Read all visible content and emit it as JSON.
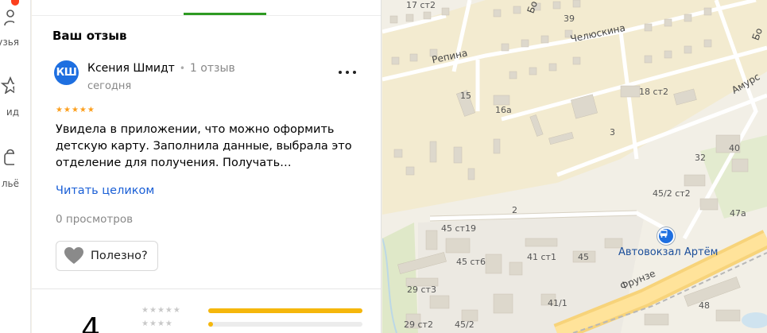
{
  "rail": {
    "items": [
      {
        "label": "узья",
        "icon": "friends-icon"
      },
      {
        "label": "ид",
        "icon": "star-icon"
      },
      {
        "label": "льё",
        "icon": "bag-icon"
      }
    ]
  },
  "review": {
    "section_title": "Ваш отзыв",
    "author": {
      "initials": "КШ",
      "name": "Ксения Шмидт",
      "separator": "•",
      "reviews_count": "1 отзыв",
      "date": "сегодня"
    },
    "rating_stars": [
      "★",
      "★",
      "★",
      "★",
      "★"
    ],
    "text": "Увидела в приложении, что можно оформить детскую карту. Заполнила данные, выбрала это отделение для получения. Получать…",
    "read_more": "Читать целиком",
    "views": "0 просмотров",
    "useful_label": "Полезно?"
  },
  "rating_summary": {
    "value": "4",
    "distribution": [
      {
        "stars": [
          "★",
          "★",
          "★",
          "★",
          "★"
        ],
        "fraction": 1.0
      },
      {
        "stars": [
          "★",
          "★",
          "★",
          "★"
        ],
        "fraction": 0.03
      }
    ]
  },
  "map": {
    "labels": [
      {
        "text": "17 ст2",
        "kind": "house"
      },
      {
        "text": "39",
        "kind": "house"
      },
      {
        "text": "Репина",
        "kind": "street"
      },
      {
        "text": "Челюскина",
        "kind": "street"
      },
      {
        "text": "15",
        "kind": "house"
      },
      {
        "text": "16а",
        "kind": "house"
      },
      {
        "text": "18 ст2",
        "kind": "house"
      },
      {
        "text": "Амурс",
        "kind": "street"
      },
      {
        "text": "3",
        "kind": "house"
      },
      {
        "text": "40",
        "kind": "house"
      },
      {
        "text": "32",
        "kind": "house"
      },
      {
        "text": "45/2 ст2",
        "kind": "house"
      },
      {
        "text": "2",
        "kind": "house"
      },
      {
        "text": "47а",
        "kind": "house"
      },
      {
        "text": "45 ст19",
        "kind": "house"
      },
      {
        "text": "45 ст6",
        "kind": "house"
      },
      {
        "text": "41 ст1",
        "kind": "house"
      },
      {
        "text": "45",
        "kind": "house"
      },
      {
        "text": "29 ст3",
        "kind": "house"
      },
      {
        "text": "41/1",
        "kind": "house"
      },
      {
        "text": "Фрунзе",
        "kind": "street"
      },
      {
        "text": "48",
        "kind": "house"
      },
      {
        "text": "29 ст2",
        "kind": "house"
      },
      {
        "text": "45/2",
        "kind": "house"
      },
      {
        "text": "Бо",
        "kind": "street"
      },
      {
        "text": "Бо",
        "kind": "street"
      }
    ],
    "poi": {
      "name": "Автовокзал Артём",
      "icon": "bus-station-icon"
    }
  }
}
